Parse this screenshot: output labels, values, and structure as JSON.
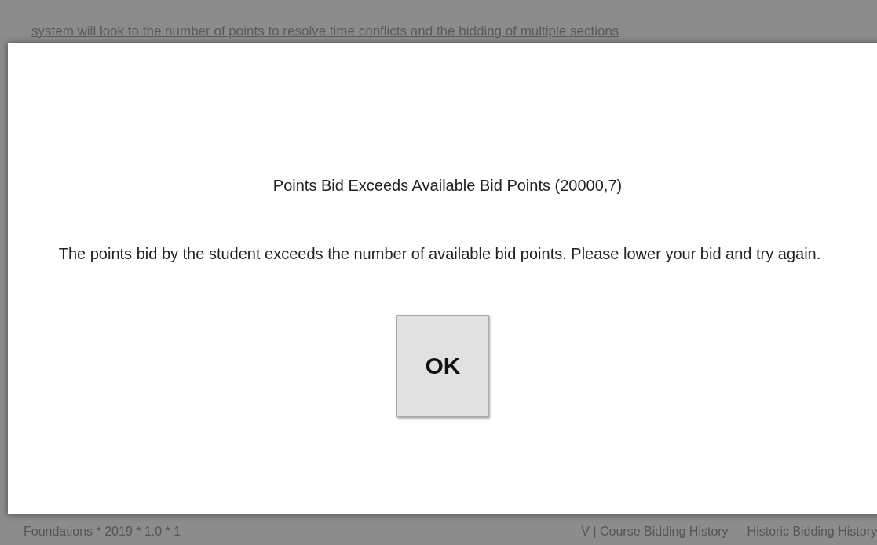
{
  "background": {
    "lines": [
      "system will look to the number of points to resolve time conflicts and the bidding of multiple sections"
    ],
    "footer": {
      "left": "Foundations * 2019 * 1.0 * 1",
      "right": [
        "V | Course Bidding History",
        "Historic Bidding History"
      ]
    }
  },
  "dialog": {
    "title": "Points Bid Exceeds Available Bid Points (20000,7)",
    "message": "The points bid by the student exceeds the number of available bid points. Please lower your bid and try again.",
    "button": "OK"
  }
}
